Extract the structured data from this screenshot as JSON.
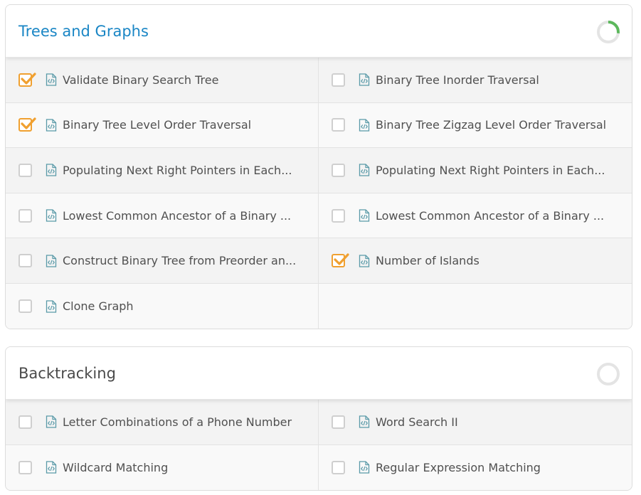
{
  "sections": [
    {
      "title": "Trees and Graphs",
      "progress": 0.27,
      "progress_color": "#5cb85c",
      "items": [
        {
          "label": "Validate Binary Search Tree",
          "checked": true
        },
        {
          "label": "Binary Tree Inorder Traversal",
          "checked": false
        },
        {
          "label": "Binary Tree Level Order Traversal",
          "checked": true
        },
        {
          "label": "Binary Tree Zigzag Level Order Traversal",
          "checked": false
        },
        {
          "label": "Populating Next Right Pointers in Each...",
          "checked": false
        },
        {
          "label": "Populating Next Right Pointers in Each...",
          "checked": false
        },
        {
          "label": "Lowest Common Ancestor of a Binary ...",
          "checked": false
        },
        {
          "label": "Lowest Common Ancestor of a Binary ...",
          "checked": false
        },
        {
          "label": "Construct Binary Tree from Preorder an...",
          "checked": false
        },
        {
          "label": "Number of Islands",
          "checked": true
        },
        {
          "label": "Clone Graph",
          "checked": false
        }
      ]
    },
    {
      "title": "Backtracking",
      "progress": 0,
      "progress_color": "#5cb85c",
      "items": [
        {
          "label": "Letter Combinations of a Phone Number",
          "checked": false
        },
        {
          "label": "Word Search II",
          "checked": false
        },
        {
          "label": "Wildcard Matching",
          "checked": false
        },
        {
          "label": "Regular Expression Matching",
          "checked": false
        }
      ]
    }
  ],
  "colors": {
    "accent_title": "#1a86c5",
    "check": "#f0a030",
    "icon": "#5a9aa8"
  },
  "icons": {
    "file": "code-file-icon",
    "check": "checkmark-icon",
    "progress": "progress-ring-icon"
  }
}
